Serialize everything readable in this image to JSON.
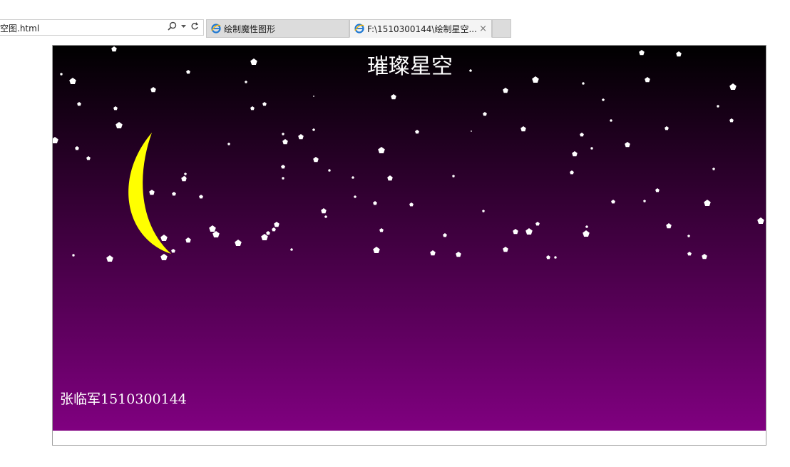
{
  "browser": {
    "address_text": "空图.html",
    "tabs": [
      {
        "label": "绘制魔性图形",
        "active": false,
        "icon": "ie-icon"
      },
      {
        "label": "F:\\1510300144\\绘制星空...",
        "active": true,
        "icon": "ie-icon",
        "close": "×"
      }
    ],
    "icons": [
      "search-icon",
      "dropdown-icon",
      "refresh-icon"
    ]
  },
  "page": {
    "title": "璀璨星空",
    "author": "张临军1510300144"
  },
  "colors": {
    "sky_top": "#000000",
    "sky_bottom": "#800080",
    "moon": "#ffff00",
    "star": "#ffffff",
    "title_text": "#ffffff"
  }
}
